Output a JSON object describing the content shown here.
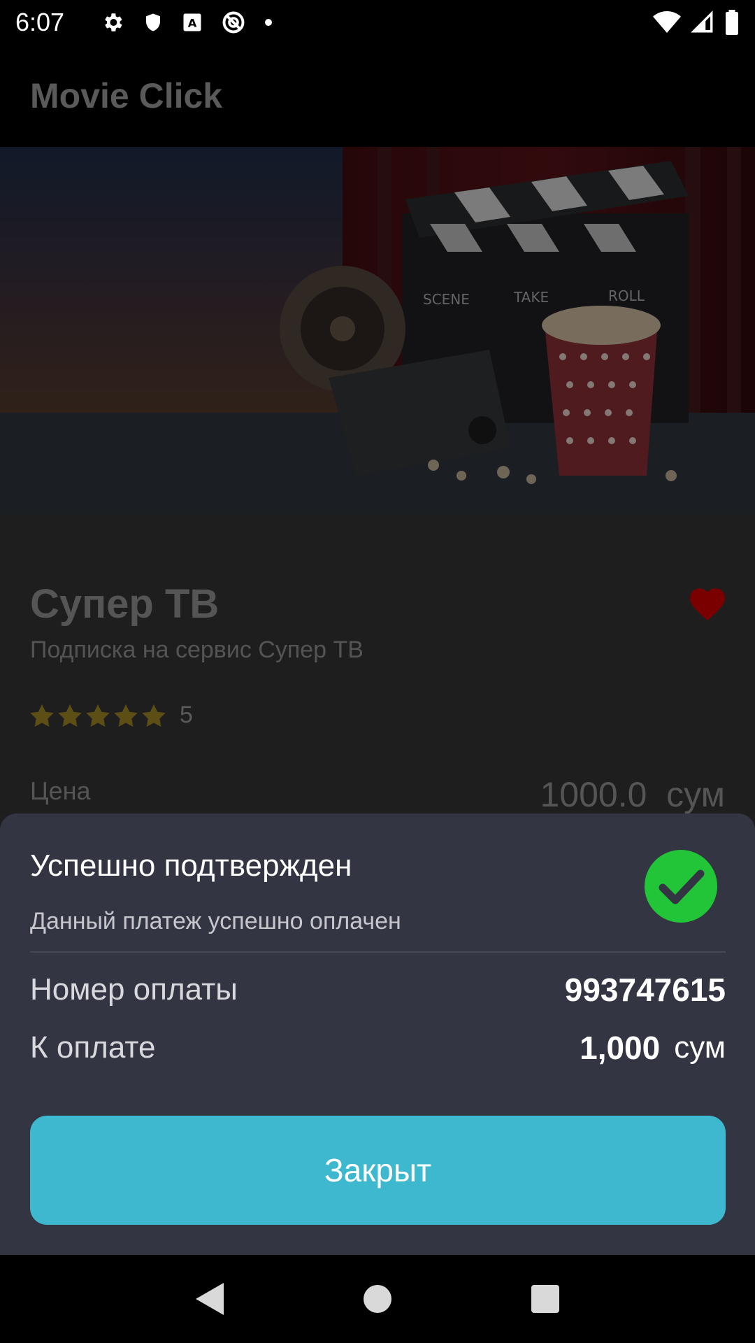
{
  "status_bar": {
    "time": "6:07",
    "icons_left": [
      "gear-icon",
      "shield-icon",
      "font-icon",
      "no-entry-icon",
      "dot-icon"
    ],
    "icons_right": [
      "wifi-icon",
      "signal-icon",
      "battery-icon"
    ]
  },
  "app_bar": {
    "title": "Movie Click"
  },
  "product": {
    "title": "Супер ТВ",
    "subtitle": "Подписка на сервис Супер ТВ",
    "rating_stars": 5,
    "rating_value": "5",
    "price_label": "Цена",
    "price_value": "1000.0  сум",
    "favorite_color": "#7a0000"
  },
  "sheet": {
    "title": "Успешно подтвержден",
    "subtitle": "Данный платеж успешно оплачен",
    "status_color": "#21c537",
    "rows": [
      {
        "label": "Номер оплаты",
        "value": "993747615",
        "unit": ""
      },
      {
        "label": "К оплате",
        "value": "1,000",
        "unit": "сум"
      }
    ],
    "close_label": "Закрыт",
    "button_color": "#3db8cf"
  },
  "nav_bar": {
    "icons": [
      "back-icon",
      "home-icon",
      "recents-icon"
    ]
  }
}
